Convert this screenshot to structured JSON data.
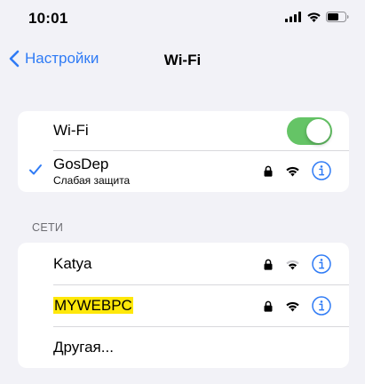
{
  "status_bar": {
    "time": "10:01"
  },
  "nav": {
    "back_label": "Настройки",
    "title": "Wi-Fi"
  },
  "wifi_toggle": {
    "label": "Wi-Fi",
    "on": true
  },
  "current_network": {
    "name": "GosDep",
    "subtitle": "Слабая защита"
  },
  "networks_section": {
    "header": "СЕТИ",
    "items": [
      {
        "name": "Katya",
        "locked": true
      },
      {
        "name": "MYWEBPC",
        "locked": true,
        "highlighted": true
      },
      {
        "name": "Другая..."
      }
    ]
  },
  "colors": {
    "accent": "#2f7bf5",
    "toggle_on": "#65c466",
    "highlight": "#ffe80a",
    "background": "#f2f2f7"
  }
}
